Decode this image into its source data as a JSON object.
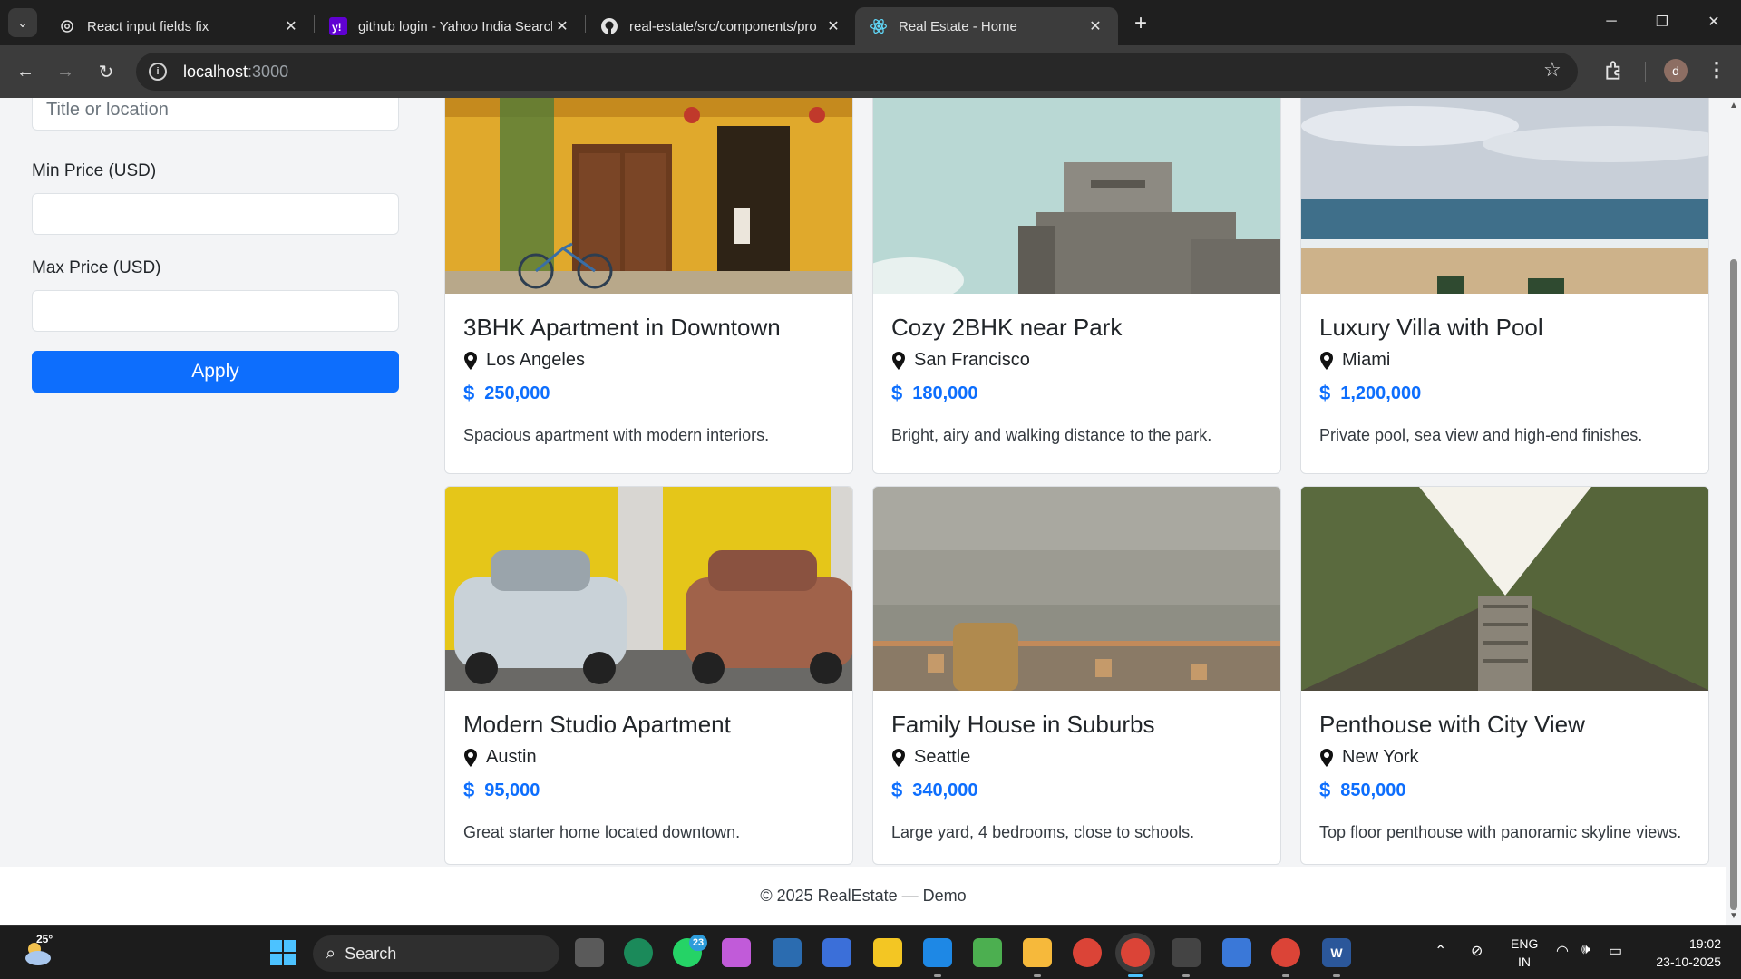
{
  "browser": {
    "tabs": [
      {
        "label": "React input fields fix",
        "icon": "openai-icon",
        "active": false
      },
      {
        "label": "github login - Yahoo India Search",
        "icon": "yahoo-icon",
        "active": false
      },
      {
        "label": "real-estate/src/components/pro",
        "icon": "github-icon",
        "active": false
      },
      {
        "label": "Real Estate - Home",
        "icon": "react-icon",
        "active": true
      }
    ],
    "address_host": "localhost",
    "address_port": ":3000"
  },
  "filters": {
    "search_placeholder": "Title or location",
    "min_label": "Min Price (USD)",
    "min_value": "",
    "max_label": "Max Price (USD)",
    "max_value": "",
    "apply_label": "Apply"
  },
  "listings": [
    {
      "title": "3BHK Apartment in Downtown",
      "location": "Los Angeles",
      "price": "250,000",
      "description": "Spacious apartment with modern interiors."
    },
    {
      "title": "Cozy 2BHK near Park",
      "location": "San Francisco",
      "price": "180,000",
      "description": "Bright, airy and walking distance to the park."
    },
    {
      "title": "Luxury Villa with Pool",
      "location": "Miami",
      "price": "1,200,000",
      "description": "Private pool, sea view and high-end finishes."
    },
    {
      "title": "Modern Studio Apartment",
      "location": "Austin",
      "price": "95,000",
      "description": "Great starter home located downtown."
    },
    {
      "title": "Family House in Suburbs",
      "location": "Seattle",
      "price": "340,000",
      "description": "Large yard, 4 bedrooms, close to schools."
    },
    {
      "title": "Penthouse with City View",
      "location": "New York",
      "price": "850,000",
      "description": "Top floor penthouse with panoramic skyline views."
    }
  ],
  "currency_symbol": "$",
  "footer": {
    "text": "© 2025 RealEstate — Demo"
  },
  "taskbar": {
    "weather_temp": "25°",
    "search_label": "Search",
    "whatsapp_badge": "23",
    "lang_line1": "ENG",
    "lang_line2": "IN",
    "time": "19:02",
    "date": "23-10-2025"
  },
  "colors": {
    "accent": "#0d6efd",
    "tab_bar": "#1f1f1f",
    "toolbar": "#3c3c3c"
  }
}
